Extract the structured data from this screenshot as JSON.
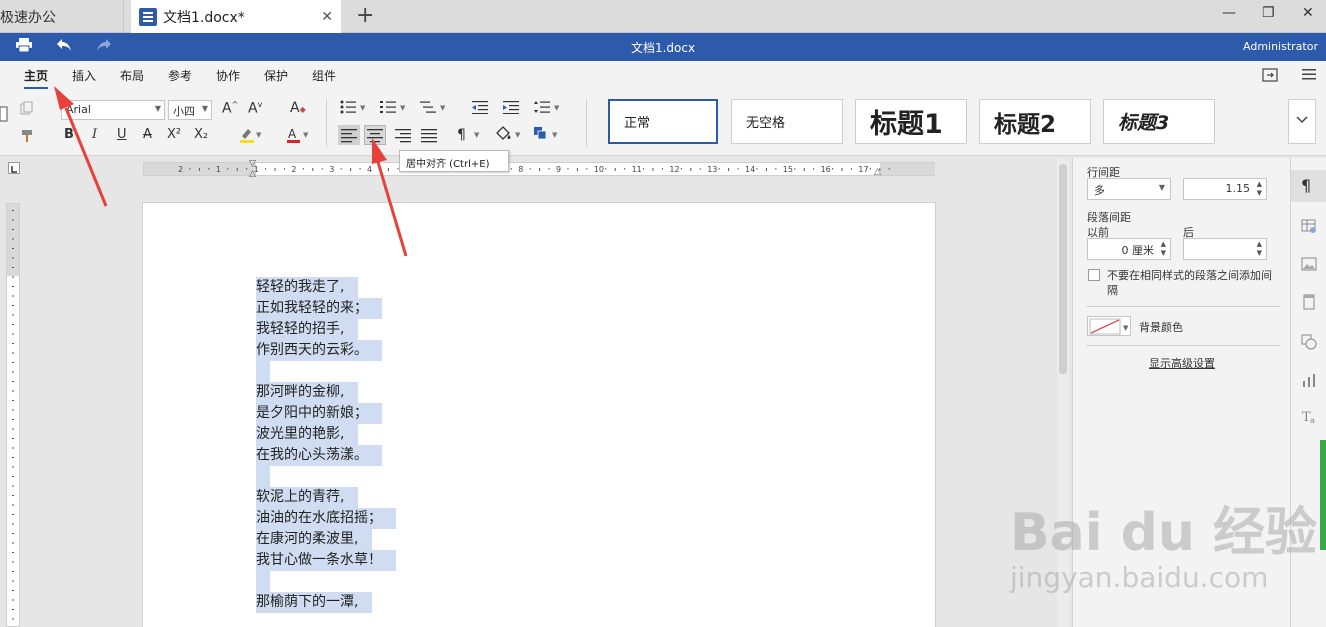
{
  "tabs": {
    "app_name": "极速办公",
    "doc_tab": "文档1.docx*",
    "add": "+"
  },
  "window": {
    "minimize": "—",
    "maximize": "❐",
    "close": "✕"
  },
  "titlebar": {
    "doc_title": "文档1.docx",
    "user": "Administrator"
  },
  "menu": {
    "items": [
      "主页",
      "插入",
      "布局",
      "参考",
      "协作",
      "保护",
      "组件"
    ],
    "active": "主页"
  },
  "ribbon": {
    "font_name": "Arial",
    "font_size": "小四",
    "bold": "B",
    "italic": "I",
    "underline": "U",
    "strike": "A",
    "superscript": "X²",
    "subscript": "X₂",
    "styles": [
      "正常",
      "无空格",
      "标题1",
      "标题2",
      "标题3"
    ],
    "tooltip": "居中对齐 (Ctrl+E)"
  },
  "ruler": {
    "h_labels": [
      "2",
      "1",
      "1",
      "2",
      "3",
      "4",
      "5",
      "6",
      "7",
      "8",
      "9",
      "10",
      "11",
      "12",
      "13",
      "14",
      "15",
      "16",
      "17"
    ]
  },
  "document": {
    "lines": [
      "轻轻的我走了,",
      "正如我轻轻的来；",
      "我轻轻的招手,",
      "作别西天的云彩。",
      "",
      "那河畔的金柳,",
      "是夕阳中的新娘；",
      "波光里的艳影,",
      "在我的心头荡漾。",
      "",
      "软泥上的青荇,",
      "油油的在水底招摇；",
      "在康河的柔波里,",
      "我甘心做一条水草！",
      "",
      "那榆荫下的一潭,"
    ]
  },
  "panel": {
    "line_spacing_label": "行间距",
    "line_spacing_type": "多",
    "line_spacing_value": "1.15",
    "para_spacing_label": "段落间距",
    "before_label": "以前",
    "after_label": "后",
    "before_value": "0 厘米",
    "after_value": "",
    "no_space_checkbox": "不要在相同样式的段落之间添加间隔",
    "bg_color_label": "背景颜色",
    "advanced_link": "显示高级设置"
  },
  "watermark": {
    "main": "Bai du 经验",
    "sub": "jingyan.baidu.com"
  },
  "colors": {
    "brand": "#2e5aac",
    "selection": "#cfdcf1",
    "arrow": "#e8403a"
  }
}
